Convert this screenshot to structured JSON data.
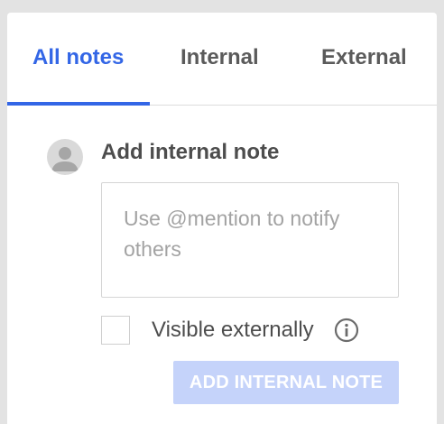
{
  "tabs": {
    "all_notes": "All notes",
    "internal": "Internal",
    "external": "External"
  },
  "note_form": {
    "heading": "Add internal note",
    "placeholder": "Use @mention to notify others",
    "visible_label": "Visible externally",
    "visible_checked": false,
    "submit_label": "ADD INTERNAL NOTE"
  },
  "colors": {
    "accent": "#3366e6",
    "button_disabled": "#c5d3fa"
  },
  "icons": {
    "avatar": "user-avatar-icon",
    "info": "info-circle-icon"
  }
}
